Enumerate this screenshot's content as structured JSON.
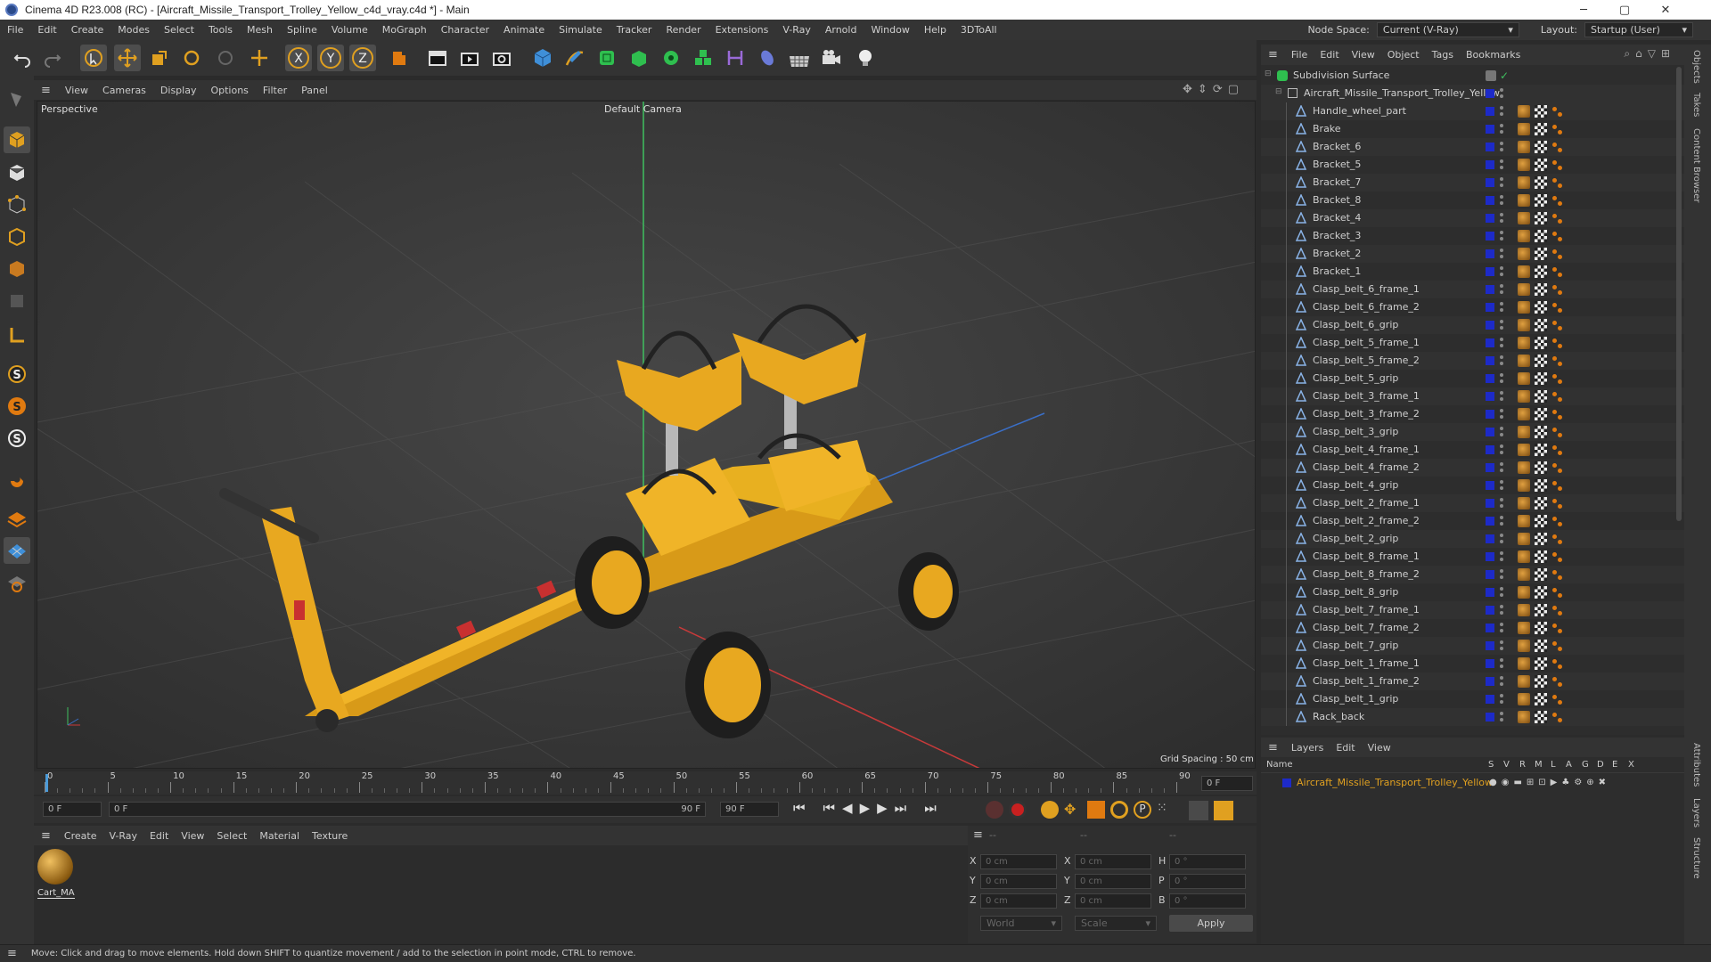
{
  "window": {
    "title": "Cinema 4D R23.008 (RC) - [Aircraft_Missile_Transport_Trolley_Yellow_c4d_vray.c4d *] - Main",
    "minimize": "─",
    "maximize": "▢",
    "close": "✕"
  },
  "menubar": {
    "items": [
      "File",
      "Edit",
      "Create",
      "Modes",
      "Select",
      "Tools",
      "Mesh",
      "Spline",
      "Volume",
      "MoGraph",
      "Character",
      "Animate",
      "Simulate",
      "Tracker",
      "Render",
      "Extensions",
      "V-Ray",
      "Arnold",
      "Window",
      "Help",
      "3DToAll"
    ],
    "node_space_label": "Node Space:",
    "node_space_value": "Current (V-Ray)",
    "layout_label": "Layout:",
    "layout_value": "Startup (User)"
  },
  "viewport": {
    "menu": [
      "View",
      "Cameras",
      "Display",
      "Options",
      "Filter",
      "Panel"
    ],
    "view_name": "Perspective",
    "camera": "Default Camera",
    "grid_spacing": "Grid Spacing : 50 cm"
  },
  "timeline": {
    "ticks": [
      "0",
      "5",
      "10",
      "15",
      "20",
      "25",
      "30",
      "35",
      "40",
      "45",
      "50",
      "55",
      "60",
      "65",
      "70",
      "75",
      "80",
      "85",
      "90"
    ],
    "current_frame": "0 F",
    "start": "0 F",
    "range_start": "0 F",
    "range_end": "90 F",
    "end": "90 F"
  },
  "material_manager": {
    "menu": [
      "Create",
      "V-Ray",
      "Edit",
      "View",
      "Select",
      "Material",
      "Texture"
    ],
    "materials": [
      {
        "name": "Cart_MA"
      }
    ]
  },
  "coordinates": {
    "header": [
      "--",
      "--",
      "--"
    ],
    "rows": [
      {
        "a": "X",
        "av": "0 cm",
        "b": "X",
        "bv": "0 cm",
        "c": "H",
        "cv": "0 °"
      },
      {
        "a": "Y",
        "av": "0 cm",
        "b": "Y",
        "bv": "0 cm",
        "c": "P",
        "cv": "0 °"
      },
      {
        "a": "Z",
        "av": "0 cm",
        "b": "Z",
        "bv": "0 cm",
        "c": "B",
        "cv": "0 °"
      }
    ],
    "mode": "World",
    "scale": "Scale",
    "apply": "Apply"
  },
  "object_manager": {
    "menu": [
      "File",
      "Edit",
      "View",
      "Object",
      "Tags",
      "Bookmarks"
    ],
    "root": "Subdivision Surface",
    "group": "Aircraft_Missile_Transport_Trolley_Yellow",
    "objects": [
      "Handle_wheel_part",
      "Brake",
      "Bracket_6",
      "Bracket_5",
      "Bracket_7",
      "Bracket_8",
      "Bracket_4",
      "Bracket_3",
      "Bracket_2",
      "Bracket_1",
      "Clasp_belt_6_frame_1",
      "Clasp_belt_6_frame_2",
      "Clasp_belt_6_grip",
      "Clasp_belt_5_frame_1",
      "Clasp_belt_5_frame_2",
      "Clasp_belt_5_grip",
      "Clasp_belt_3_frame_1",
      "Clasp_belt_3_frame_2",
      "Clasp_belt_3_grip",
      "Clasp_belt_4_frame_1",
      "Clasp_belt_4_frame_2",
      "Clasp_belt_4_grip",
      "Clasp_belt_2_frame_1",
      "Clasp_belt_2_frame_2",
      "Clasp_belt_2_grip",
      "Clasp_belt_8_frame_1",
      "Clasp_belt_8_frame_2",
      "Clasp_belt_8_grip",
      "Clasp_belt_7_frame_1",
      "Clasp_belt_7_frame_2",
      "Clasp_belt_7_grip",
      "Clasp_belt_1_frame_1",
      "Clasp_belt_1_frame_2",
      "Clasp_belt_1_grip",
      "Rack_back"
    ]
  },
  "layers_manager": {
    "menu": [
      "Layers",
      "Edit",
      "View"
    ],
    "columns": [
      "Name",
      "S",
      "V",
      "R",
      "M",
      "L",
      "A",
      "G",
      "D",
      "E",
      "X"
    ],
    "layer_name": "Aircraft_Missile_Transport_Trolley_Yellow",
    "layer_color": "#1d2ac8"
  },
  "right_tabs": [
    "Objects",
    "Takes",
    "Content Browser",
    "Attributes",
    "Layers",
    "Structure"
  ],
  "status": "Move: Click and drag to move elements. Hold down SHIFT to quantize movement / add to the selection in point mode, CTRL to remove.",
  "colors": {
    "accent": "#e0a020",
    "layer_blue": "#1d2ac8",
    "trolley_yellow": "#e8b020"
  }
}
